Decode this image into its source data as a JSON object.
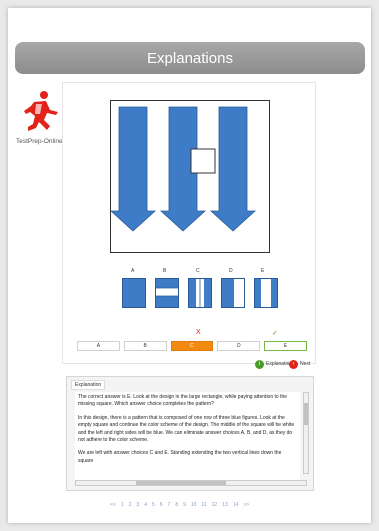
{
  "header": {
    "title": "Explanations"
  },
  "brand": {
    "name": "TestPrep-Online",
    "logo_icon": "runner-logo-icon",
    "logo_color": "#e2231a"
  },
  "question": {
    "choice_labels": [
      "A",
      "B",
      "C",
      "D",
      "E"
    ],
    "answers": [
      "A",
      "B",
      "C",
      "D",
      "E"
    ],
    "selected": "C",
    "correct": "E",
    "wrong_mark": "X",
    "correct_mark": "✓"
  },
  "buttons": {
    "explanation": "Explanation",
    "next": "Next"
  },
  "explanation": {
    "title": "Explanation",
    "paragraphs": [
      "The correct answer is E. Look at the design in the large rectangle, while paying attention to the missing square. Which answer choice completes the pattern?",
      "In this design, there is a pattern that is composed of one row of three blue figures. Look at the empty square and continue the color scheme of the design. The middle of the square will be white and the left and right sides will be blue. We can eliminate answer choices A, B, and D, as they do not adhere to the color scheme.",
      "We are left with answer choices C and E. Standing extending the two vertical lines down the square"
    ]
  },
  "pager": {
    "prev": "<<",
    "pages": [
      "1",
      "2",
      "3",
      "4",
      "5",
      "6",
      "7",
      "8",
      "9",
      "10",
      "11",
      "12",
      "13",
      "14"
    ],
    "next": ">>"
  },
  "colors": {
    "shape_blue": "#3f7cc7",
    "shape_border": "#2a5b96",
    "accent_orange": "#f28a12",
    "correct_green": "#7ab648",
    "header_gray": "#9a9a9a"
  }
}
